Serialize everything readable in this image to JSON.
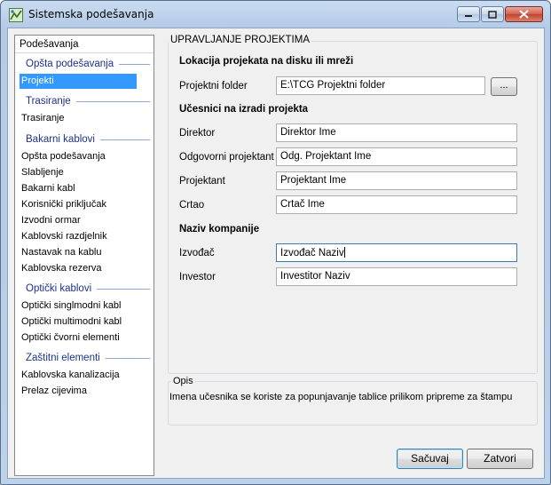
{
  "window": {
    "title": "Sistemska podešavanja"
  },
  "nav": {
    "header": "Podešavanja",
    "groups": {
      "general": "Opšta podešavanja",
      "routing": "Trasiranje",
      "copper": "Bakarni kablovi",
      "optical": "Optički kablovi",
      "protective": "Zaštitni elementi"
    },
    "items": {
      "projekti": "Projekti",
      "trasiranje": "Trasiranje",
      "opsta": "Opšta podešavanja",
      "slabljenje": "Slabljenje",
      "bakarni_kabl": "Bakarni kabl",
      "korisnicki": "Korisnički priključak",
      "izvodni_ormar": "Izvodni ormar",
      "kablovski_razdjelnik": "Kablovski razdjelnik",
      "nastavak": "Nastavak na kablu",
      "rezerva": "Kablovska rezerva",
      "singlmodni": "Optički singlmodni kabl",
      "multimodni": "Optički multimodni kabl",
      "cvorni": "Optički čvorni elementi",
      "kanalizacija": "Kablovska kanalizacija",
      "prelaz": "Prelaz cijevima"
    }
  },
  "panel": {
    "title": "UPRAVLJANJE PROJEKTIMA",
    "location": {
      "heading": "Lokacija projekata na disku ili mreži",
      "folder_label": "Projektni folder",
      "folder_value": "E:\\TCG Projektni folder",
      "browse_label": "..."
    },
    "participants": {
      "heading": "Učesnici na izradi projekta",
      "director_label": "Direktor",
      "director_value": "Direktor Ime",
      "responsible_label": "Odgovorni projektant",
      "responsible_value": "Odg. Projektant Ime",
      "designer_label": "Projektant",
      "designer_value": "Projektant Ime",
      "drafter_label": "Crtao",
      "drafter_value": "Crtač Ime"
    },
    "company": {
      "heading": "Naziv kompanije",
      "contractor_label": "Izvođač",
      "contractor_value": "Izvođač Naziv",
      "investor_label": "Investor",
      "investor_value": "Investitor Naziv"
    }
  },
  "description": {
    "title": "Opis",
    "text": "Imena učesnika se koriste za popunjavanje tablice prilikom pripreme za štampu"
  },
  "buttons": {
    "save": "Sačuvaj",
    "close": "Zatvori"
  },
  "colors": {
    "selection": "#3399ff",
    "group_header": "#1e3287",
    "dialog_bg": "#f0f0f0"
  }
}
